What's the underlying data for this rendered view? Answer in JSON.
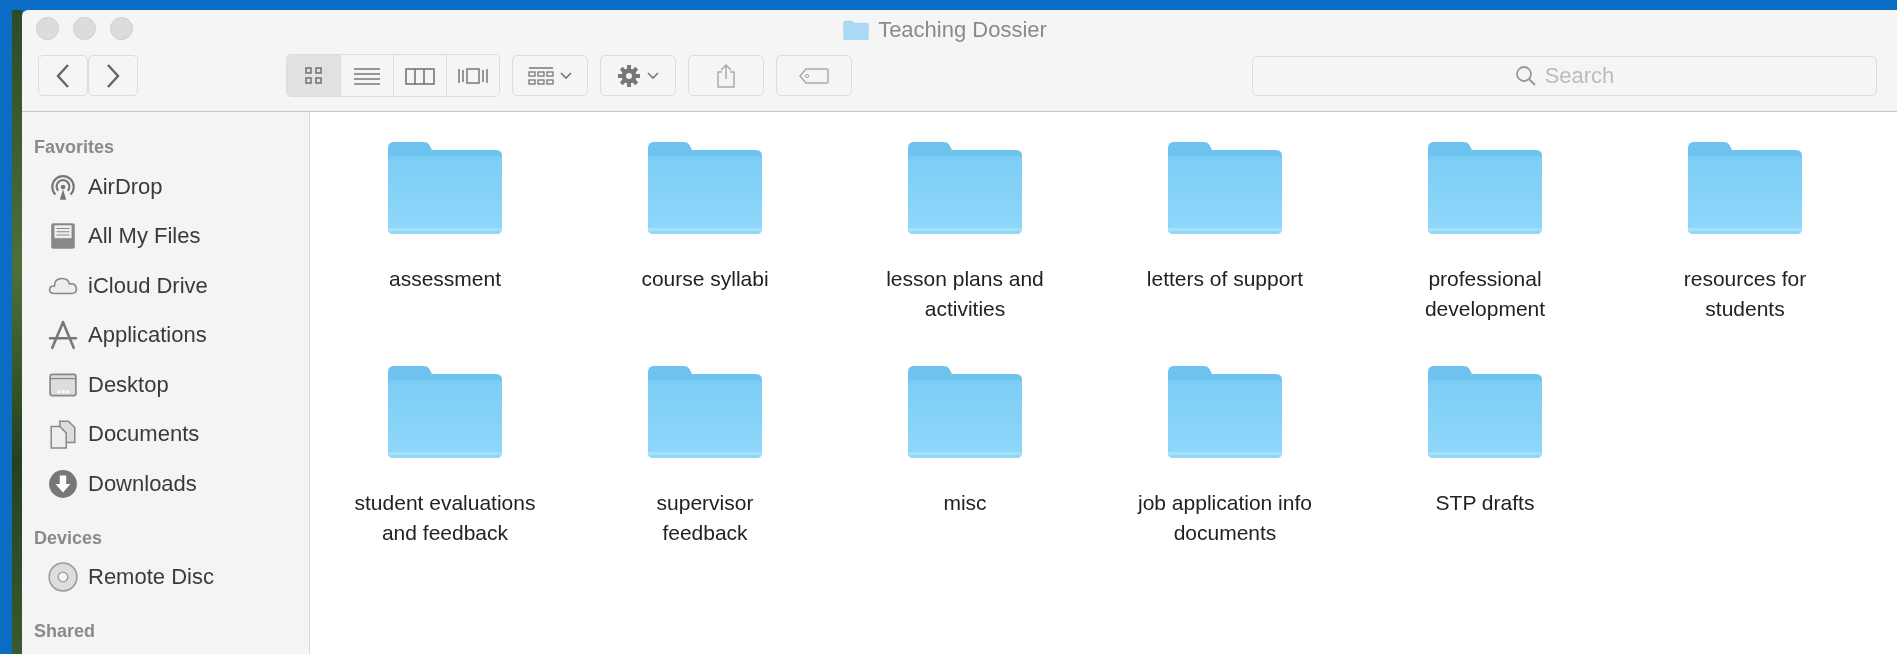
{
  "window": {
    "title": "Teaching Dossier"
  },
  "toolbar": {
    "view_modes": [
      {
        "kind": "icons",
        "selected": true
      },
      {
        "kind": "list",
        "selected": false
      },
      {
        "kind": "columns",
        "selected": false
      },
      {
        "kind": "coverflow",
        "selected": false
      }
    ]
  },
  "search": {
    "placeholder": "Search"
  },
  "sidebar": {
    "sections": [
      {
        "title": "Favorites",
        "items": [
          {
            "label": "AirDrop",
            "kind": "airdrop"
          },
          {
            "label": "All My Files",
            "kind": "allfiles"
          },
          {
            "label": "iCloud Drive",
            "kind": "icloud"
          },
          {
            "label": "Applications",
            "kind": "applications"
          },
          {
            "label": "Desktop",
            "kind": "desktop"
          },
          {
            "label": "Documents",
            "kind": "documents"
          },
          {
            "label": "Downloads",
            "kind": "downloads"
          }
        ]
      },
      {
        "title": "Devices",
        "items": [
          {
            "label": "Remote Disc",
            "kind": "disc"
          }
        ]
      },
      {
        "title": "Shared"
      }
    ]
  },
  "folders": [
    {
      "name": "assessment"
    },
    {
      "name": "course syllabi"
    },
    {
      "name": "lesson plans and activities"
    },
    {
      "name": "letters of support"
    },
    {
      "name": "professional development"
    },
    {
      "name": "resources for students"
    },
    {
      "name": "student evaluations and feedback"
    },
    {
      "name": "supervisor feedback"
    },
    {
      "name": "misc"
    },
    {
      "name": "job application info documents"
    },
    {
      "name": "STP drafts"
    }
  ]
}
